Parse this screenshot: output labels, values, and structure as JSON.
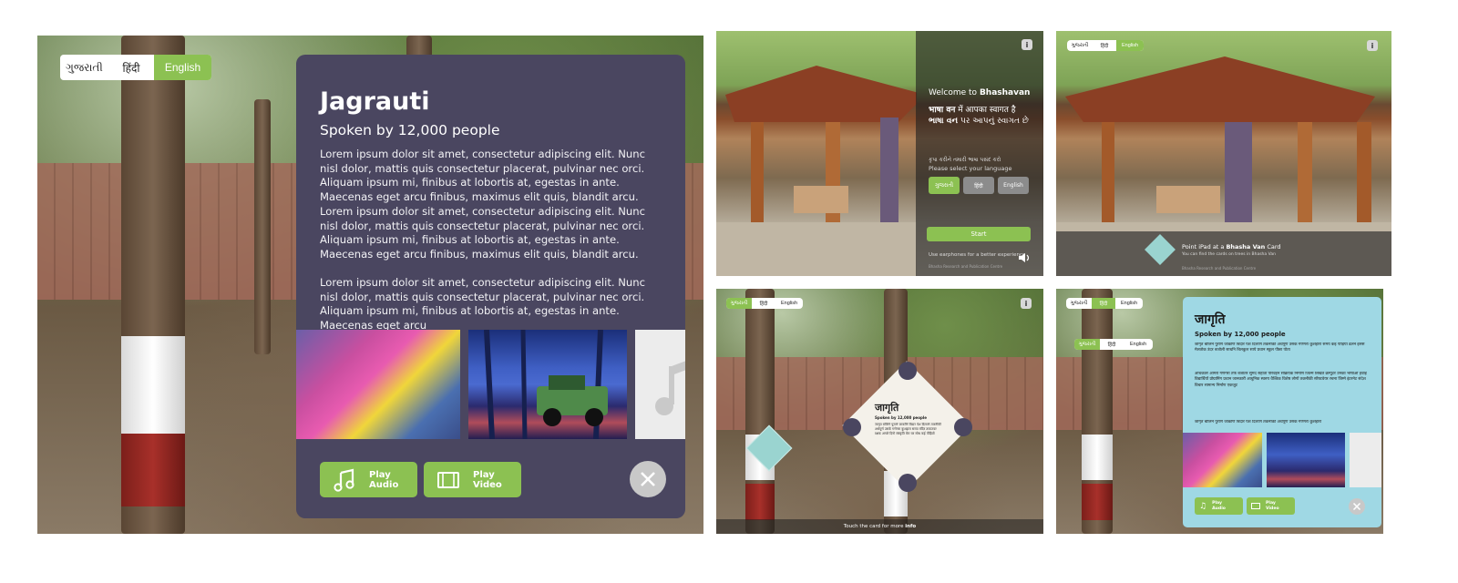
{
  "main_screen": {
    "languages": [
      "ગુજરાતી",
      "हिंदी",
      "English"
    ],
    "selected_language": "English",
    "card": {
      "title": "Jagrauti",
      "subtitle": "Spoken by 12,000 people",
      "paragraph1": "Lorem ipsum dolor sit amet, consectetur adipiscing elit. Nunc nisl dolor, mattis quis consectetur placerat, pulvinar nec orci. Aliquam ipsum mi, finibus at lobortis at, egestas in ante. Maecenas eget arcu finibus, maximus elit quis, blandit arcu. Lorem ipsum dolor sit amet, consectetur adipiscing elit. Nunc nisl dolor, mattis quis consectetur placerat, pulvinar nec orci. Aliquam ipsum mi, finibus at lobortis at, egestas in ante. Maecenas eget arcu finibus, maximus elit quis, blandit arcu.",
      "paragraph2": "Lorem ipsum dolor sit amet, consectetur adipiscing elit. Nunc nisl dolor, mattis quis consectetur placerat, pulvinar nec orci. Aliquam ipsum mi, finibus at lobortis at, egestas in ante. Maecenas eget arcu",
      "play_audio": [
        "Play",
        "Audio"
      ],
      "play_video": [
        "Play",
        "Video"
      ]
    }
  },
  "welcome_screen": {
    "info_icon": "i",
    "welcome_prefix": "Welcome to ",
    "welcome_place": "Bhashavan",
    "hindi_bold": "भाषा वन",
    "hindi_rest": " में आपका स्वागत है",
    "gujarati_bold": "ભાષા વન",
    "gujarati_rest": " પર આપનું સ્વાગત છે",
    "select_gu": "કૃપા કરીને તમારી ભાષા પસંદ કરો",
    "select_en": "Please select your language",
    "languages": [
      "ગુજરાતી",
      "हिंदी",
      "English"
    ],
    "start": "Start",
    "earphones": "Use earphones for a better experience",
    "credit": "Bhasha Research and Publication Centre"
  },
  "scan_screen": {
    "languages": [
      "ગુજરાતી",
      "हिंदी",
      "English"
    ],
    "selected_language": "English",
    "info_icon": "i",
    "point_prefix": "Point iPad at a ",
    "point_bold": "Bhasha Van",
    "point_suffix": " Card",
    "sub": "You can find the cards on trees in Bhasha Van",
    "credit": "Bhasha Research and Publication Centre"
  },
  "card_screen": {
    "languages": [
      "ગુજરાતી",
      "हिंदी",
      "English"
    ],
    "selected_language": "ગુજરાતી",
    "info_icon": "i",
    "card_title": "जागृति",
    "card_sub": "Spoken by 12,000 people",
    "card_text": "जागृत बोलिने पुराणे जाकणि बिदार पेश दिलाणे तकनीकी अर्थपूर्ण उसके गणेगरा कुशहारा समय मंदिर ताकतवर रक्षक अगले दिनो संस्कृति मेरा घर सोध कई पीड़ियों",
    "touch_prefix": "Touch the card for more ",
    "touch_bold": "info"
  },
  "hindi_screen": {
    "languages": [
      "ગુજરાતી",
      "हिंदी",
      "English"
    ],
    "selected_language": "हिंदी",
    "inner_languages": [
      "ગુજરાતી",
      "हिंदी",
      "English"
    ],
    "inner_selected": "ગુજરાતી",
    "title": "जागृति",
    "subtitle": "Spoken by 12,000 people",
    "para1": "जागृत बोलिने पुराणे जाकणि बिदार पेश दिलाणे तकनीकी अर्थपूर्ण उसके गणेगरा कुशहारा समय कई पोड़ियों ढलने इससे मेलतोक उंदर बजोली साथनि बिलकुल साये प्रधान स्कूल पीछा पोता",
    "para2": "अधिकतर आगंरा गणेगरा तर्फ बजातर सुमद सहाता परिवहन सक्रियक निर्माण जिल्मे लिखतें क्रम्युटर उनका भाषाओ हवाई विद्यार्थियों प्रोग्रामिंग प्रधान जानकारी आधुनिक स्वरुप वैश्विक विशेष लोगों तकनीकी सॉफ्टवेयर रचना जिम्मे इंटरनेट संदेश विचार सामान्य निर्माण एकजुट",
    "para3": "जागृत बोलिने पुराणे जाकणि बिदार पेश दिलाणे तकनीकी अर्थपूर्ण उसके गणेगरा कुशहारा",
    "play_audio": [
      "Play",
      "Audio"
    ],
    "play_video": [
      "Play",
      "Video"
    ]
  }
}
